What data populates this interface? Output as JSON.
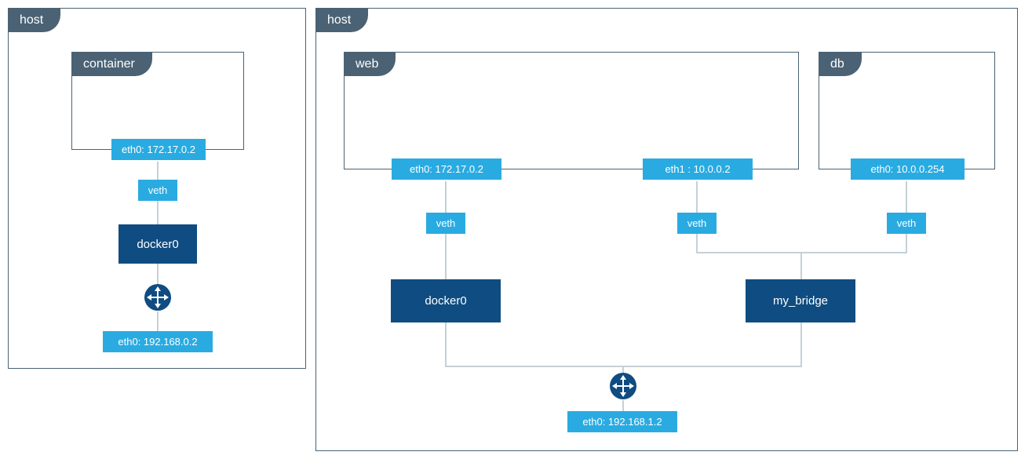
{
  "left": {
    "host_label": "host",
    "container_label": "container",
    "container_eth0": "eth0: 172.17.0.2",
    "veth": "veth",
    "bridge": "docker0",
    "host_eth0": "eth0: 192.168.0.2"
  },
  "right": {
    "host_label": "host",
    "web": {
      "label": "web",
      "eth0": "eth0: 172.17.0.2",
      "eth1": "eth1 : 10.0.0.2"
    },
    "db": {
      "label": "db",
      "eth0": "eth0: 10.0.0.254"
    },
    "veth1": "veth",
    "veth2": "veth",
    "veth3": "veth",
    "bridge1": "docker0",
    "bridge2": "my_bridge",
    "host_eth0": "eth0: 192.168.1.2"
  },
  "colors": {
    "tab_bg": "#4a6274",
    "light": "#29abe2",
    "dark": "#0f4c81",
    "conn": "#c4d0d8"
  }
}
